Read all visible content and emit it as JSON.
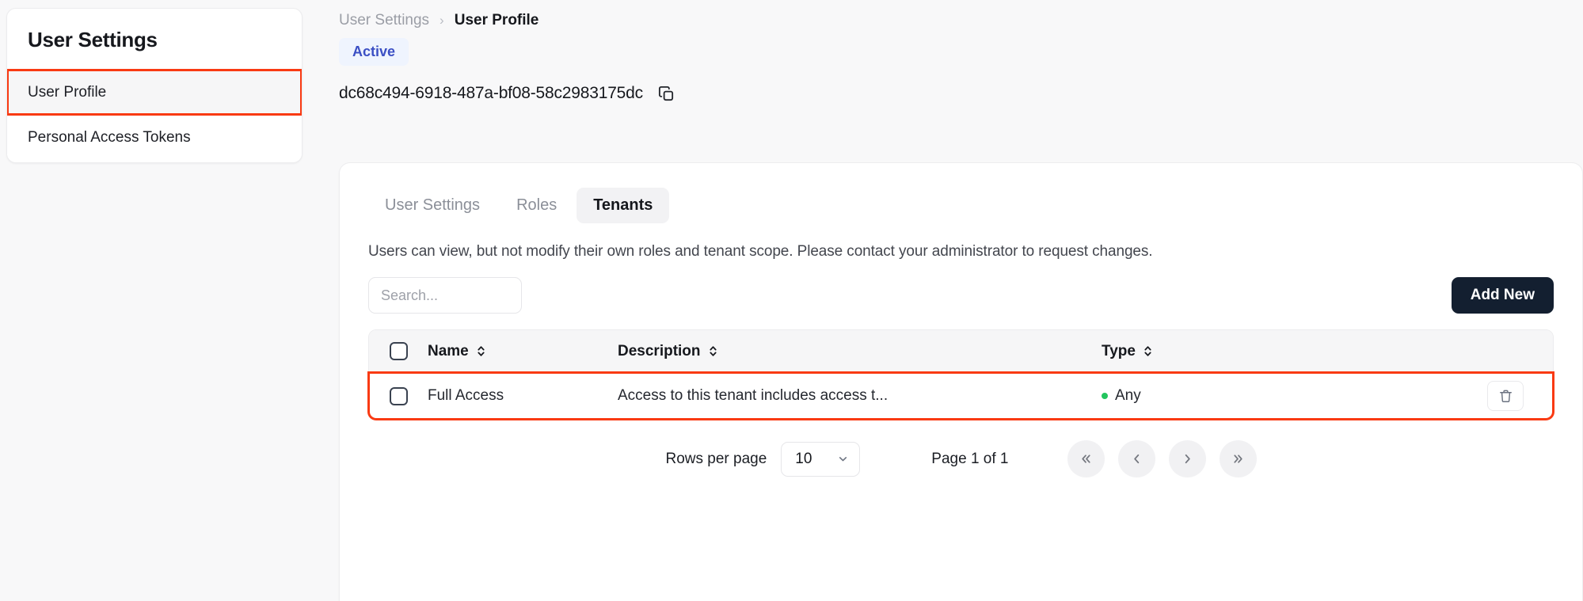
{
  "sidebar": {
    "title": "User Settings",
    "items": [
      {
        "label": "User Profile",
        "active": true
      },
      {
        "label": "Personal Access Tokens",
        "active": false
      }
    ]
  },
  "breadcrumb": {
    "parent": "User Settings",
    "separator": "›",
    "current": "User Profile"
  },
  "header": {
    "status_badge": "Active",
    "user_id": "dc68c494-6918-487a-bf08-58c2983175dc",
    "copy_icon": "copy-icon"
  },
  "tabs": [
    {
      "label": "User Settings",
      "active": false
    },
    {
      "label": "Roles",
      "active": false
    },
    {
      "label": "Tenants",
      "active": true
    }
  ],
  "table_panel": {
    "description": "Users can view, but not modify their own roles and tenant scope. Please contact your administrator to request changes.",
    "search": {
      "value": "",
      "placeholder": "Search..."
    },
    "add_new_label": "Add New",
    "columns": [
      {
        "label": "Name",
        "sortable": true
      },
      {
        "label": "Description",
        "sortable": true
      },
      {
        "label": "Type",
        "sortable": true
      }
    ],
    "rows": [
      {
        "selected": false,
        "name": "Full Access",
        "description": "Access to this tenant includes access t...",
        "type": "Any",
        "type_dot_color": "#22c55e",
        "delete_icon": "trash-icon"
      }
    ]
  },
  "pagination": {
    "rows_per_page_label": "Rows per page",
    "rows_per_page_value": "10",
    "page_indicator": "Page 1 of 1",
    "first_label": "«",
    "prev_label": "‹",
    "next_label": "›",
    "last_label": "»"
  },
  "colors": {
    "accent_dark": "#131f30",
    "badge_bg": "#eff4fe",
    "badge_text": "#3b4fc4",
    "highlight_outline": "#f93a13",
    "status_green": "#22c55e",
    "page_bg": "#f8f8f9"
  }
}
